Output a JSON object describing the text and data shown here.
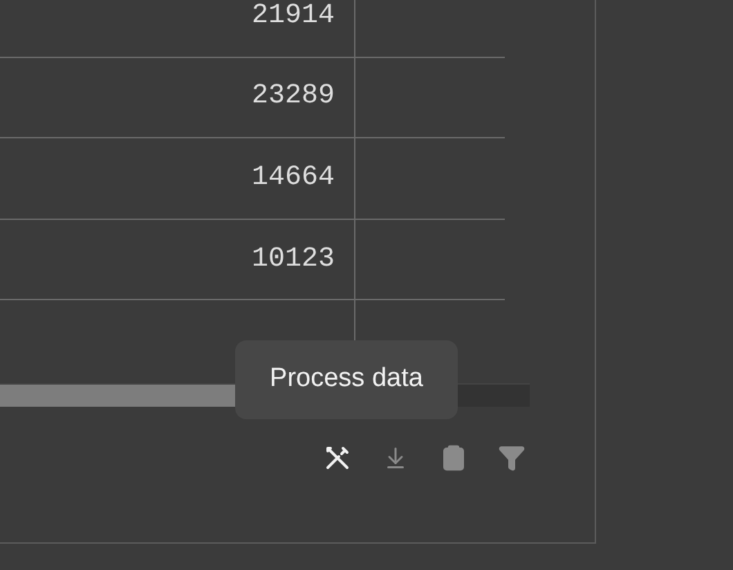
{
  "table": {
    "rows": [
      {
        "value": "21914"
      },
      {
        "value": "23289"
      },
      {
        "value": "14664"
      },
      {
        "value": "10123"
      }
    ]
  },
  "tooltip": {
    "text": "Process data"
  },
  "toolbar": [
    {
      "kind": "process",
      "disabled": false
    },
    {
      "kind": "download",
      "disabled": true
    },
    {
      "kind": "clipboard",
      "disabled": true
    },
    {
      "kind": "filter",
      "disabled": true
    }
  ]
}
